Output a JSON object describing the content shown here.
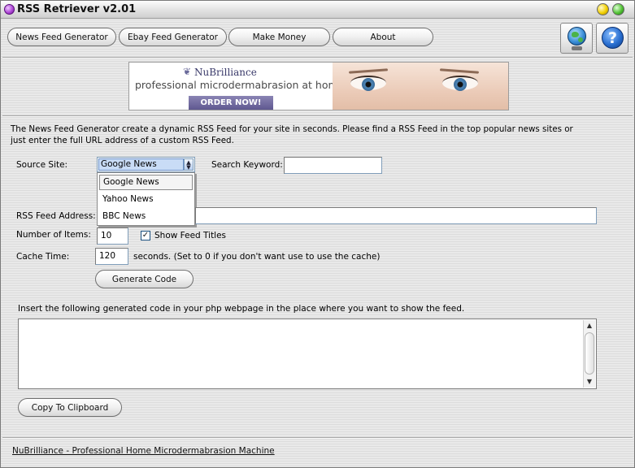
{
  "window": {
    "title": "RSS Retriever v2.01"
  },
  "toolbar": {
    "tabs": [
      {
        "label": "News Feed Generator"
      },
      {
        "label": "Ebay Feed Generator"
      },
      {
        "label": "Make Money"
      },
      {
        "label": "About"
      }
    ],
    "help_glyph": "?",
    "icons": [
      "globe-icon",
      "help-icon"
    ]
  },
  "banner": {
    "brand": "NuBrilliance",
    "tagline": "professional microdermabrasion at home!",
    "cta": "ORDER NOW!"
  },
  "form": {
    "description": "The News Feed Generator create a dynamic RSS Feed for your site in seconds. Please find a RSS Feed in the top popular news sites or just enter the full URL address of a custom RSS Feed.",
    "source_site_label": "Source Site:",
    "source_site_selected": "Google News",
    "source_site_options": [
      "Google News",
      "Yahoo News",
      "BBC News"
    ],
    "search_keyword_label": "Search Keyword:",
    "search_keyword_value": "",
    "rss_feed_address_label": "RSS Feed Address:",
    "rss_feed_address_value": "",
    "number_of_items_label": "Number of Items:",
    "number_of_items_value": "10",
    "show_feed_titles_label": "Show Feed Titles",
    "show_feed_titles_checked": true,
    "cache_time_label": "Cache Time:",
    "cache_time_value": "120",
    "cache_time_hint": "seconds. (Set to 0 if you don't want use to use the cache)",
    "generate_button": "Generate Code",
    "code_instructions": "Insert the following generated code in your php webpage in the place where you want to show the feed.",
    "generated_code": "",
    "copy_button": "Copy To Clipboard"
  },
  "footer": {
    "link_text": "NuBrilliance - Professional Home Microdermabrasion Machine"
  }
}
